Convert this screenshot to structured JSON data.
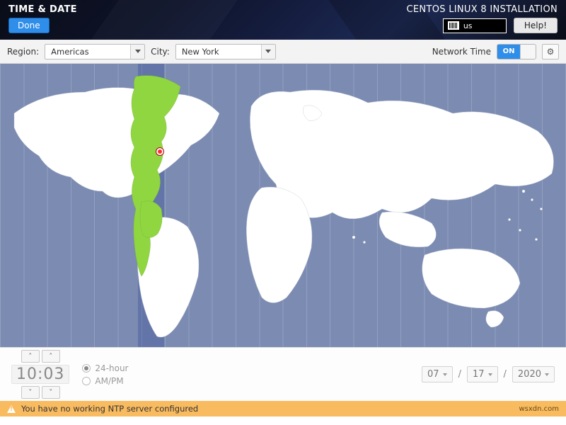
{
  "banner": {
    "screen_title": "TIME & DATE",
    "product_title": "CENTOS LINUX 8 INSTALLATION",
    "done_label": "Done",
    "help_label": "Help!",
    "keyboard_layout": "us"
  },
  "controls": {
    "region_label": "Region:",
    "region_value": "Americas",
    "city_label": "City:",
    "city_value": "New York",
    "network_time_label": "Network Time",
    "network_time_state": "ON"
  },
  "time": {
    "display": "10:03",
    "format_24h_label": "24-hour",
    "format_ampm_label": "AM/PM",
    "format_selected": "24-hour"
  },
  "date": {
    "month": "07",
    "day": "17",
    "year": "2020",
    "separator": "/"
  },
  "warning": {
    "message": "You have no working NTP server configured"
  },
  "watermark": "wsxdn.com"
}
